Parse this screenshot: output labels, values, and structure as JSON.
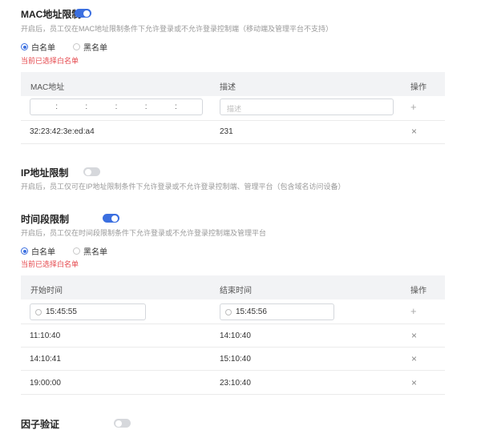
{
  "mac": {
    "title": "MAC地址限制",
    "enabled": true,
    "description": "开启后，员工仅在MAC地址限制条件下允许登录或不允许登录控制端（移动端及管理平台不支持）",
    "radio_whitelist": "白名单",
    "radio_blacklist": "黑名单",
    "selected": "白名单",
    "warning": "当前已选择白名单",
    "columns": [
      "MAC地址",
      "描述",
      "操作"
    ],
    "desc_placeholder": "描述",
    "mac_separator": ":",
    "rows": [
      {
        "mac": "32:23:42:3e:ed:a4",
        "desc": "231"
      }
    ]
  },
  "ip": {
    "title": "IP地址限制",
    "enabled": false,
    "description": "开启后，员工仅可在IP地址限制条件下允许登录或不允许登录控制端、管理平台（包含域名访问设备）"
  },
  "time": {
    "title": "时间段限制",
    "enabled": true,
    "description": "开启后，员工仅在时间段限制条件下允许登录或不允许登录控制端及管理平台",
    "radio_whitelist": "白名单",
    "radio_blacklist": "黑名单",
    "selected": "白名单",
    "warning": "当前已选择白名单",
    "columns": [
      "开始时间",
      "结束时间",
      "操作"
    ],
    "input_start": "15:45:55",
    "input_end": "15:45:56",
    "rows": [
      {
        "start": "11:10:40",
        "end": "14:10:40"
      },
      {
        "start": "14:10:41",
        "end": "15:10:40"
      },
      {
        "start": "19:00:00",
        "end": "23:10:40"
      }
    ]
  },
  "factor": {
    "title": "因子验证",
    "enabled": false
  },
  "icons": {
    "add": "+",
    "delete": "×"
  },
  "colors": {
    "accent": "#3b6fe0",
    "warning": "#e5484d",
    "toggle_off": "#d6d8dc",
    "header_bg": "#f2f3f5"
  }
}
